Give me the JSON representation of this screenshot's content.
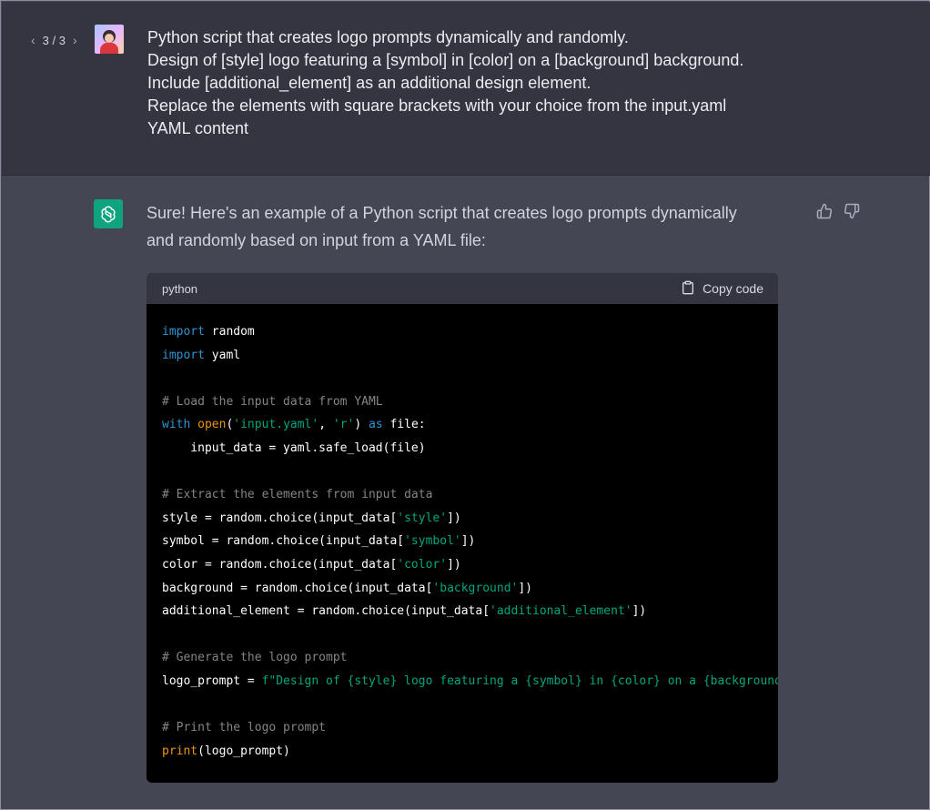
{
  "pager": {
    "prev": "‹",
    "label": "3 / 3",
    "next": "›"
  },
  "user_message": {
    "lines": [
      "Python script that creates logo prompts dynamically and randomly.",
      "Design of [style] logo featuring a [symbol] in [color] on a [background] background.",
      "Include [additional_element] as an additional design element.",
      "Replace the elements with square brackets with your choice from the input.yaml",
      "YAML content"
    ]
  },
  "reply": {
    "intro_line1": "Sure! Here's an example of a Python script that creates logo prompts dynamically",
    "intro_line2": "and randomly based on input from a YAML file:"
  },
  "code": {
    "language": "python",
    "copy_label": "Copy code",
    "kw_import": "import",
    "mod_random": " random",
    "mod_yaml": " yaml",
    "comment_load": "# Load the input data from YAML",
    "kw_with": "with",
    "fn_open": "open",
    "str_file": "'input.yaml'",
    "str_mode": "'r'",
    "kw_as": "as",
    "line_load": "    input_data = yaml.safe_load(file)",
    "comment_extract": "# Extract the elements from input data",
    "var_style": "style = random.choice(input_data[",
    "str_style": "'style'",
    "var_symbol": "symbol = random.choice(input_data[",
    "str_symbol": "'symbol'",
    "var_color": "color = random.choice(input_data[",
    "str_color": "'color'",
    "var_background": "background = random.choice(input_data[",
    "str_background": "'background'",
    "var_additional": "additional_element = random.choice(input_data[",
    "str_additional": "'additional_element'",
    "close_bracket": "])",
    "comment_generate": "# Generate the logo prompt",
    "var_prompt": "logo_prompt = ",
    "str_prompt": "f\"Design of {style} logo featuring a {symbol} in {color} on a {background}",
    "comment_print": "# Print the logo prompt",
    "fn_print": "print",
    "print_args": "(logo_prompt)"
  },
  "colors": {
    "user_bg": "#343541",
    "reply_bg": "#444654",
    "accent": "#10a37f"
  }
}
